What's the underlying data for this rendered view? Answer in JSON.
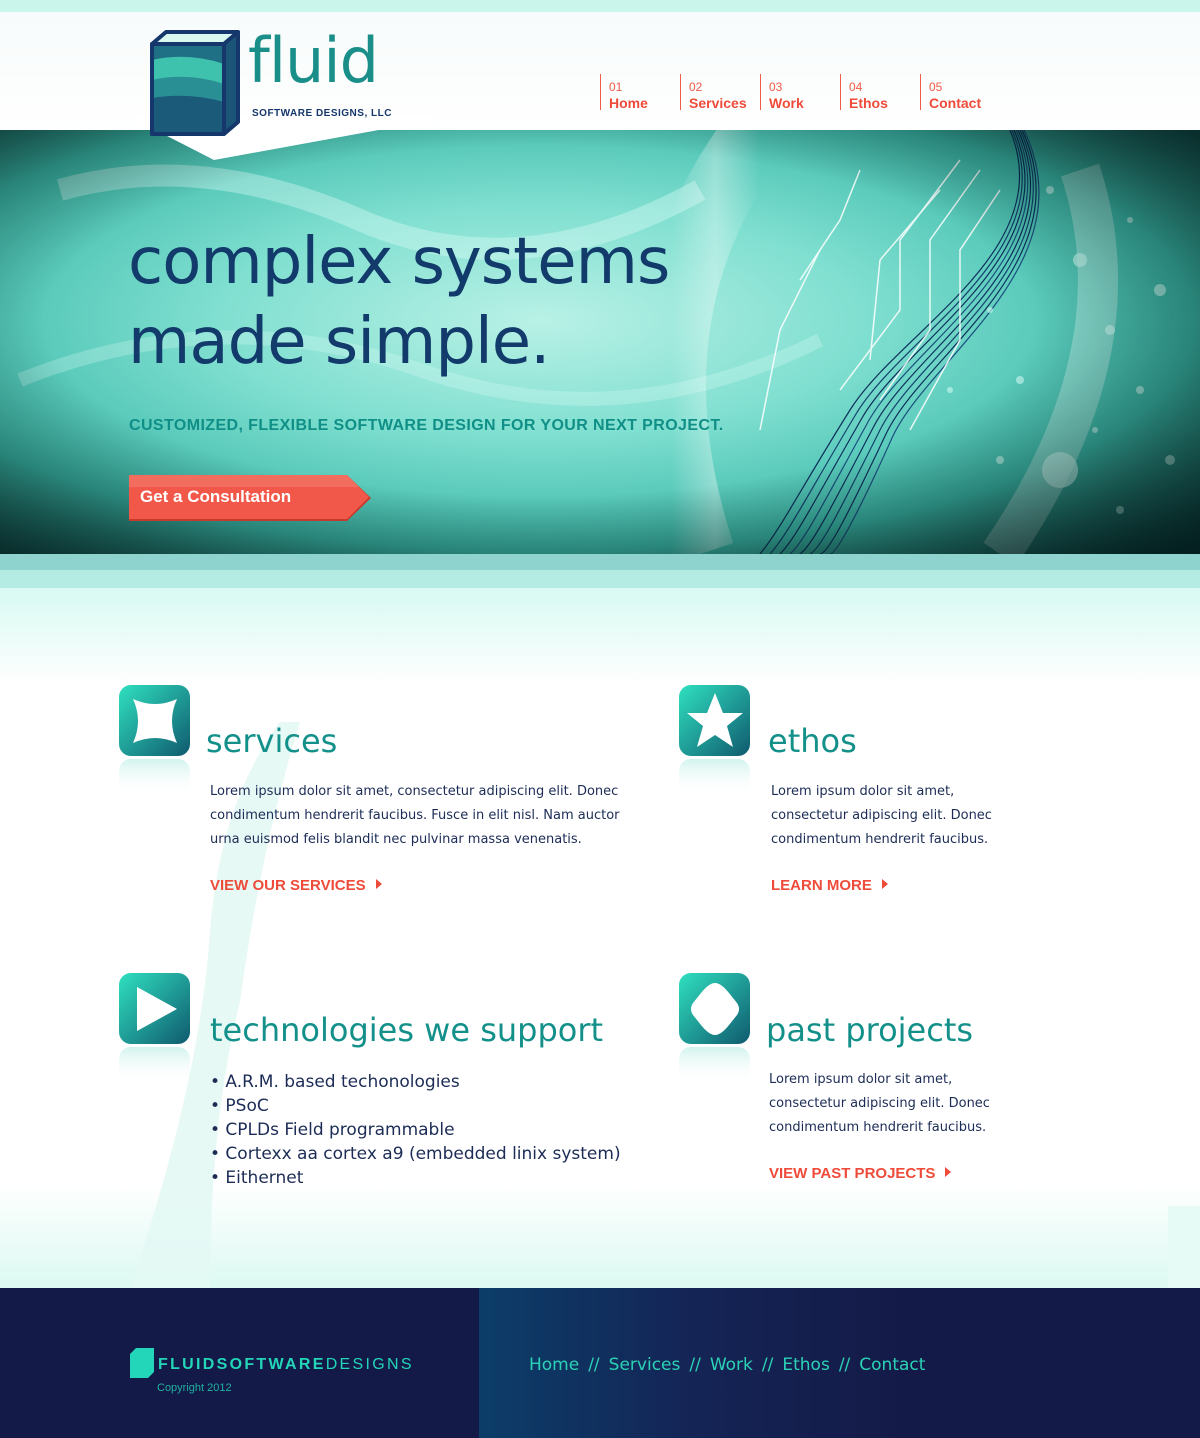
{
  "brand": {
    "logo_word": "fluid",
    "logo_subtitle": "SOFTWARE DESIGNS, LLC",
    "colors": {
      "teal": "#1a8f8a",
      "navy": "#141a47",
      "accent": "#ef4b3a",
      "mint": "#c9f5ea"
    }
  },
  "nav": {
    "items": [
      {
        "num": "01",
        "label": "Home"
      },
      {
        "num": "02",
        "label": "Services"
      },
      {
        "num": "03",
        "label": "Work"
      },
      {
        "num": "04",
        "label": "Ethos"
      },
      {
        "num": "05",
        "label": "Contact"
      }
    ]
  },
  "hero": {
    "title_line1": "complex systems",
    "title_line2": "made simple.",
    "tagline": "CUSTOMIZED, FLEXIBLE SOFTWARE DESIGN FOR YOUR NEXT PROJECT.",
    "cta_label": "Get a Consultation"
  },
  "sections": {
    "services": {
      "title": "services",
      "body": "Lorem ipsum dolor sit amet, consectetur adipiscing elit. Donec condimentum hendrerit faucibus. Fusce in elit nisl. Nam auctor urna euismod felis blandit nec pulvinar massa venenatis.",
      "link": "VIEW OUR SERVICES",
      "icon": "four-point-star-icon"
    },
    "ethos": {
      "title": "ethos",
      "body": "Lorem ipsum dolor sit amet, consectetur adipiscing elit. Donec condimentum hendrerit faucibus.",
      "link": "LEARN MORE",
      "icon": "star-icon"
    },
    "technologies": {
      "title": "technologies we support",
      "items": [
        "• A.R.M. based techonologies",
        "• PSoC",
        "• CPLDs Field programmable",
        "• Cortexx aa cortex a9 (embedded linix system)",
        "• Eithernet"
      ],
      "icon": "play-icon"
    },
    "past_projects": {
      "title": "past projects",
      "body": "Lorem ipsum dolor sit amet, consectetur adipiscing elit. Donec condimentum hendrerit faucibus.",
      "link": "VIEW PAST PROJECTS",
      "icon": "diamond-icon"
    }
  },
  "footer": {
    "logo_bold": "FLUID",
    "logo_thin1": "SOFTWARE",
    "logo_thin2": "DESIGNS",
    "copyright": "Copyright 2012",
    "separator": "//",
    "links": [
      "Home",
      "Services",
      "Work",
      "Ethos",
      "Contact"
    ]
  }
}
